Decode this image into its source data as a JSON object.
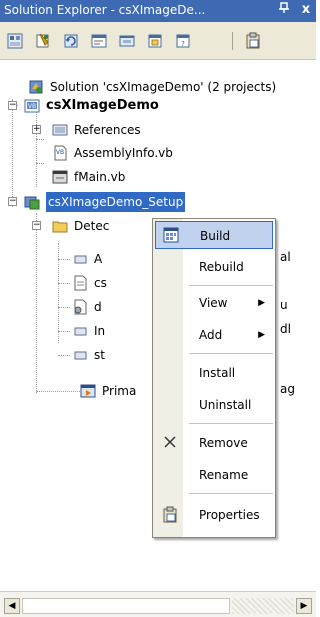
{
  "window": {
    "title": "Solution Explorer - csXImageDe...",
    "pin_glyph": "ⱎ",
    "close_glyph": "x"
  },
  "toolbar": {
    "buttons": [
      "properties-icon",
      "show-all-files-icon",
      "refresh-icon",
      "view-code-icon",
      "view-designer-icon",
      "file-system-editor-icon",
      "registry-editor-icon"
    ]
  },
  "tree": {
    "solution": "Solution 'csXImageDemo' (2 projects)",
    "project1": "csXImageDemo",
    "references": "References",
    "assemblyinfo": "AssemblyInfo.vb",
    "fmain": "fMain.vb",
    "project2": "csXImageDemo_Setup",
    "detected": "Detec",
    "child1": "A",
    "child1_tail": "al",
    "child2": "cs",
    "child3": "d",
    "child3_tail": "u",
    "child4": "In",
    "child4_tail": "dl",
    "child5": "st",
    "primary": "Prima",
    "primary_tail": "ag"
  },
  "context_menu": {
    "build": "Build",
    "rebuild": "Rebuild",
    "view": "View",
    "add": "Add",
    "install": "Install",
    "uninstall": "Uninstall",
    "remove": "Remove",
    "rename": "Rename",
    "properties": "Properties",
    "submenu_arrow": "▶"
  },
  "scrollbar": {
    "left_arrow": "◀",
    "right_arrow": "▶"
  },
  "colors": {
    "titlebar": "#3d6ab3",
    "selection": "#316ac5",
    "menu_highlight": "#c1d2ee"
  }
}
